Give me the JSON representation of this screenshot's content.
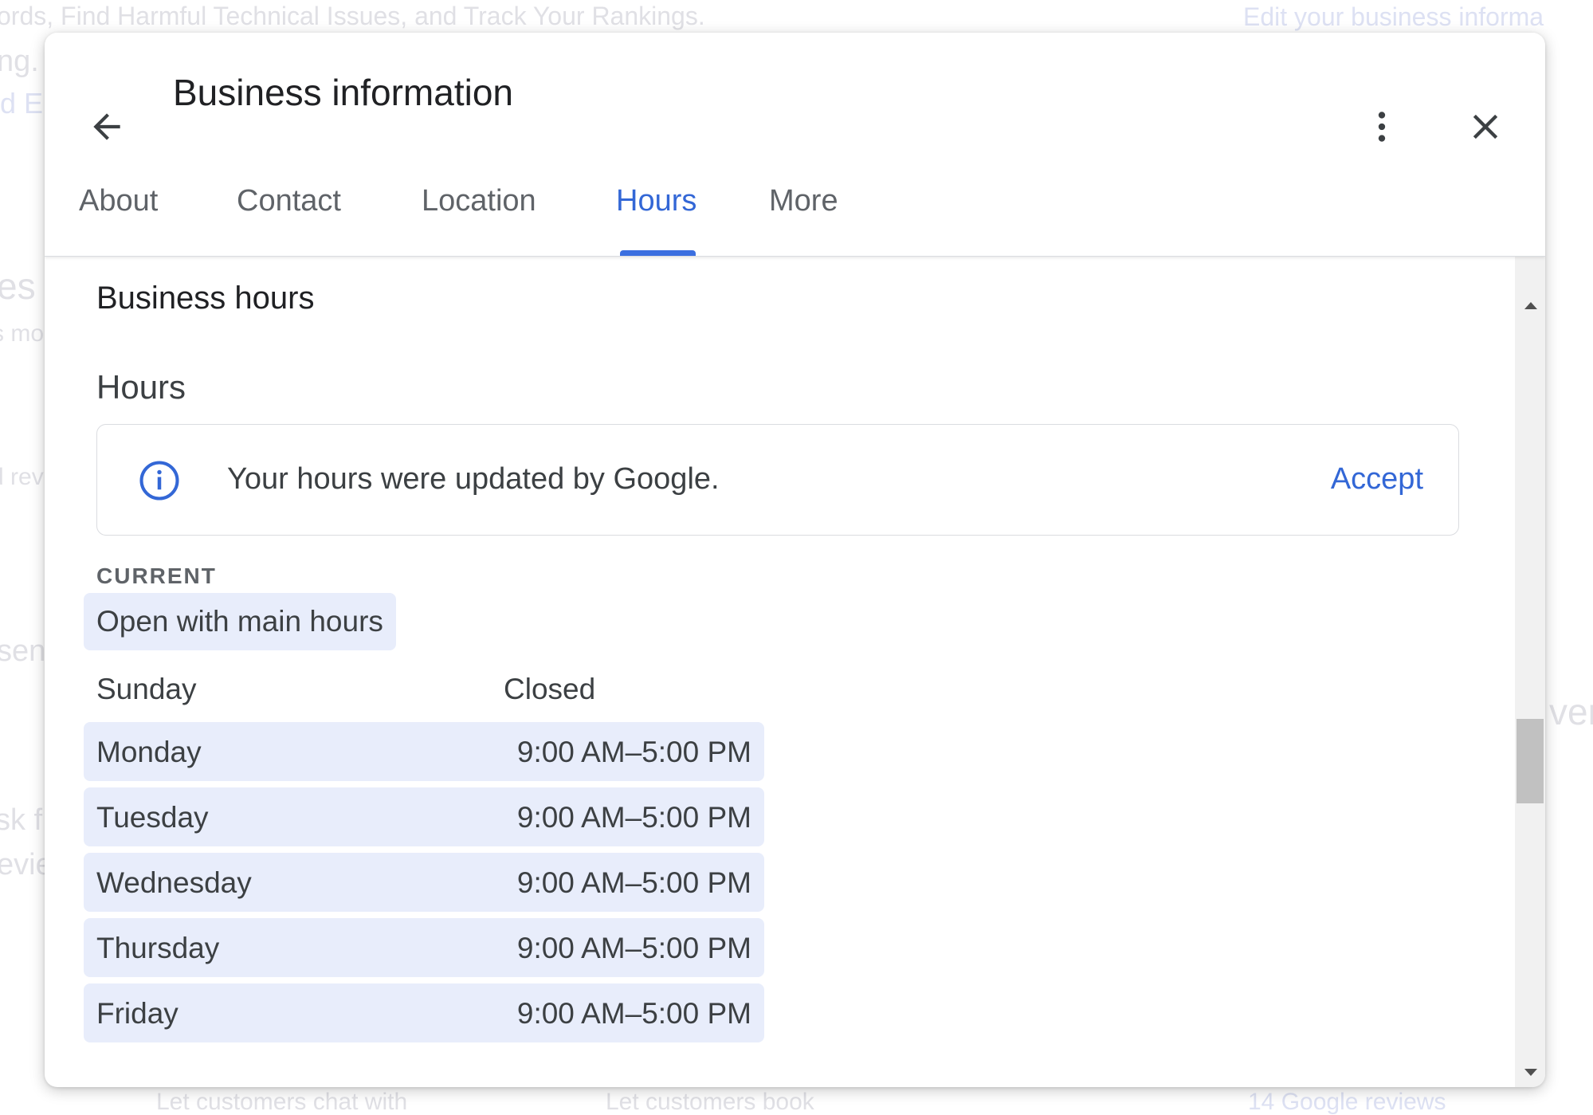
{
  "background": {
    "texts": [
      "ords, Find Harmful Technical Issues, and Track Your Rankings.",
      "Edit your business informa",
      "ng.",
      "rd E",
      "es",
      "s mo",
      "d rev",
      "sen",
      "sk f",
      "evie",
      "ven",
      "Let customers chat with",
      "Let customers book",
      "14 Google reviews"
    ]
  },
  "dialog": {
    "title": "Business information",
    "back_icon": "arrow-left-icon",
    "menu_icon": "more-vertical-icon",
    "close_icon": "close-icon",
    "tabs": [
      {
        "label": "About",
        "active": false
      },
      {
        "label": "Contact",
        "active": false
      },
      {
        "label": "Location",
        "active": false
      },
      {
        "label": "Hours",
        "active": true
      },
      {
        "label": "More",
        "active": false
      }
    ],
    "accent_color": "#3367d6"
  },
  "hours": {
    "section_title": "Business hours",
    "subtitle": "Hours",
    "notice": {
      "icon": "info-icon",
      "text": "Your hours were updated by Google.",
      "action": "Accept"
    },
    "current_label": "CURRENT",
    "status_chip": "Open with main hours",
    "days": [
      {
        "day": "Sunday",
        "hours": "Closed"
      },
      {
        "day": "Monday",
        "hours": "9:00 AM–5:00 PM"
      },
      {
        "day": "Tuesday",
        "hours": "9:00 AM–5:00 PM"
      },
      {
        "day": "Wednesday",
        "hours": "9:00 AM–5:00 PM"
      },
      {
        "day": "Thursday",
        "hours": "9:00 AM–5:00 PM"
      },
      {
        "day": "Friday",
        "hours": "9:00 AM–5:00 PM"
      }
    ]
  }
}
